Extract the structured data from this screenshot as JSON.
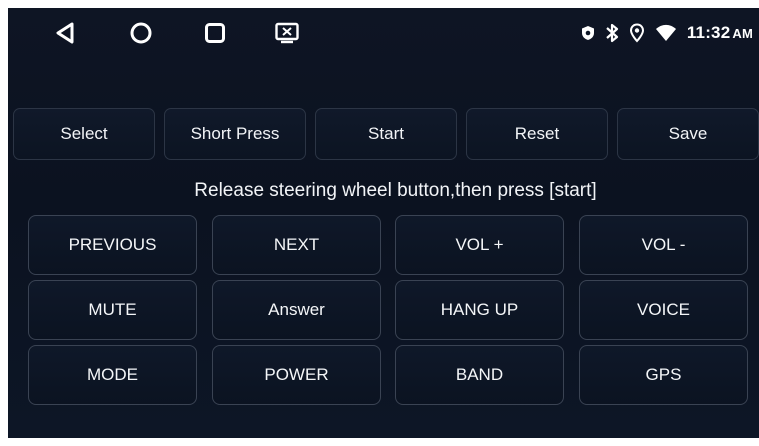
{
  "navbar": {
    "back_icon": "back-triangle-icon",
    "home_icon": "home-circle-icon",
    "recents_icon": "recents-square-icon",
    "screenshot_icon": "screen-capture-icon"
  },
  "status": {
    "icons": [
      "shield-icon",
      "bluetooth-icon",
      "location-icon",
      "wifi-icon"
    ],
    "time": "11:32",
    "ampm": "AM"
  },
  "toolbar": {
    "tabs": [
      {
        "label": "Select"
      },
      {
        "label": "Short Press"
      },
      {
        "label": "Start"
      },
      {
        "label": "Reset"
      },
      {
        "label": "Save"
      }
    ]
  },
  "instruction": "Release steering wheel button,then press [start]",
  "keys": [
    {
      "label": "PREVIOUS"
    },
    {
      "label": "NEXT"
    },
    {
      "label": "VOL +"
    },
    {
      "label": "VOL -"
    },
    {
      "label": "MUTE"
    },
    {
      "label": "Answer"
    },
    {
      "label": "HANG UP"
    },
    {
      "label": "VOICE"
    },
    {
      "label": "MODE"
    },
    {
      "label": "POWER"
    },
    {
      "label": "BAND"
    },
    {
      "label": "GPS"
    }
  ],
  "colors": {
    "background": "#0b1220",
    "button_border": "#3a4353",
    "text": "#f2f4f7"
  }
}
